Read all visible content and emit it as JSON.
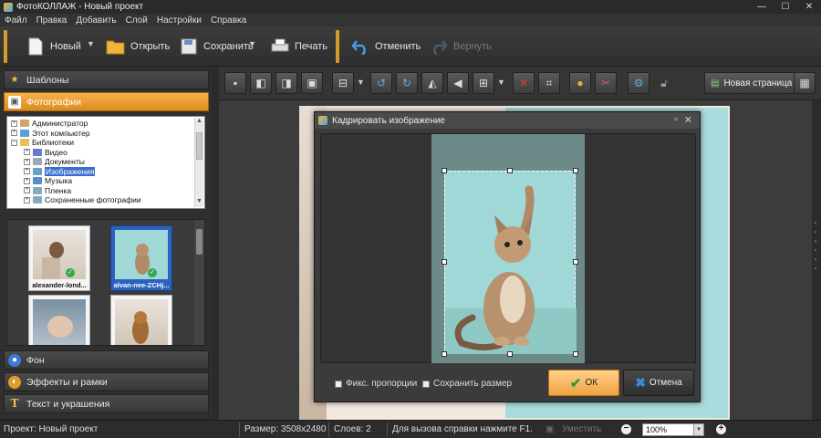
{
  "window": {
    "title": "ФотоКОЛЛАЖ - Новый проект",
    "controls": [
      "—",
      "☐",
      "✕"
    ]
  },
  "menu": [
    "Файл",
    "Правка",
    "Добавить",
    "Слой",
    "Настройки",
    "Справка"
  ],
  "toolbar": {
    "new_label": "Новый",
    "open_label": "Открыть",
    "save_label": "Сохранить",
    "print_label": "Печать",
    "undo_label": "Отменить",
    "redo_label": "Вернуть"
  },
  "sidebar": {
    "templates_label": "Шаблоны",
    "photos_label": "Фотографии",
    "background_label": "Фон",
    "effects_label": "Эффекты и рамки",
    "text_label": "Текст и украшения"
  },
  "tree": [
    {
      "label": "Администратор",
      "selected": false
    },
    {
      "label": "Этот компьютер",
      "selected": false
    },
    {
      "label": "Библиотеки",
      "selected": false
    },
    {
      "label": "Видео",
      "selected": false
    },
    {
      "label": "Документы",
      "selected": false
    },
    {
      "label": "Изображения",
      "selected": true
    },
    {
      "label": "Музыка",
      "selected": false
    },
    {
      "label": "Пленка",
      "selected": false
    },
    {
      "label": "Сохраненные фотографии",
      "selected": false
    }
  ],
  "thumbnails": [
    {
      "caption": "alexander-lond...",
      "selected": false,
      "used": true
    },
    {
      "caption": "alvan-nee-ZCHj...",
      "selected": true,
      "used": true
    },
    {
      "caption": "",
      "selected": false,
      "used": false
    },
    {
      "caption": "",
      "selected": false,
      "used": false
    }
  ],
  "edit_toolbar": {
    "new_page_label": "Новая страница"
  },
  "crop_dialog": {
    "title": "Кадрировать изображение",
    "fixed_ratio_label": "Фикс. пропорции",
    "keep_size_label": "Сохранить размер",
    "ok_label": "ОК",
    "cancel_label": "Отмена"
  },
  "status": {
    "project": "Проект:  Новый проект",
    "size": "Размер:  3508x2480",
    "layers": "Слоев:  2",
    "help": "Для вызова справки нажмите F1.",
    "fit_label": "Уместить",
    "zoom": "100%"
  }
}
